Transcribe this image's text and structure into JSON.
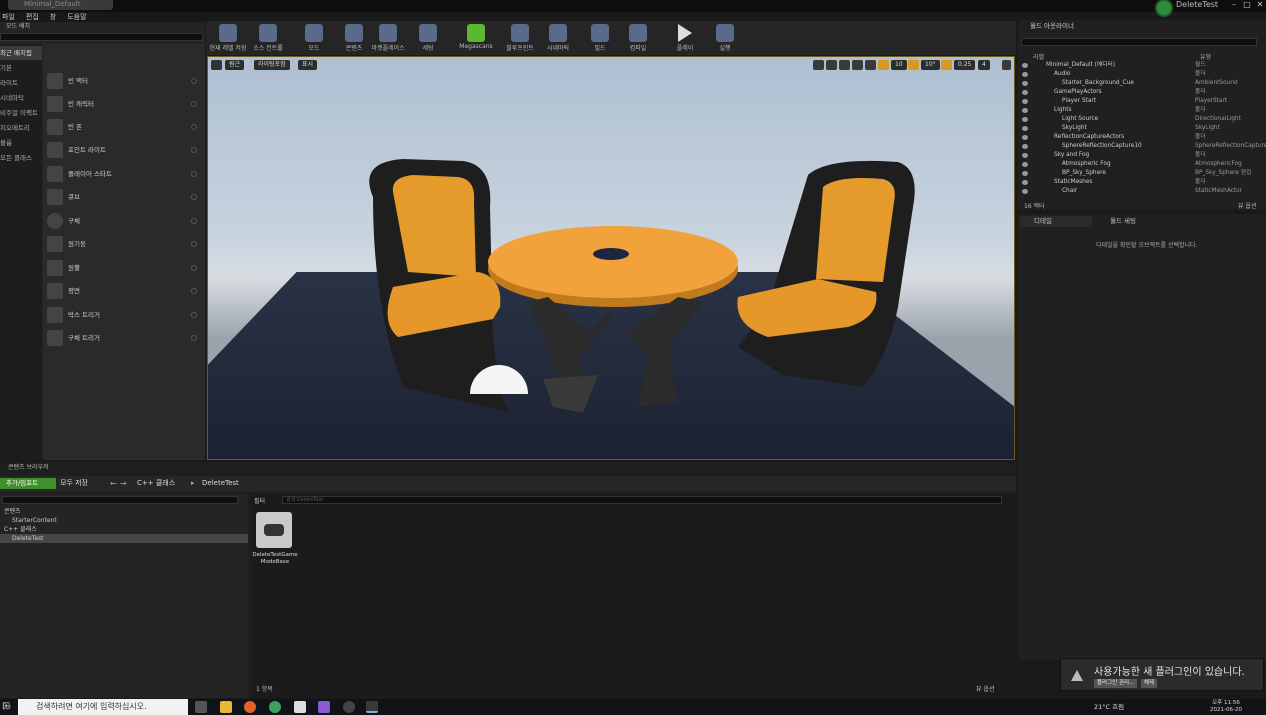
{
  "window": {
    "doc_tab": "Minimal_Default",
    "project_name": "DeleteTest"
  },
  "menu": [
    "파일",
    "편집",
    "창",
    "도움말"
  ],
  "place_panel": {
    "tab": "모드 배치",
    "categories": [
      "최근 배치됨",
      "기본",
      "라이트",
      "시네마틱",
      "비주얼 이펙트",
      "지오메트리",
      "볼륨",
      "모든 클래스"
    ],
    "items": [
      "빈 액터",
      "빈 캐릭터",
      "빈 폰",
      "포인트 라이트",
      "플레이어 스타트",
      "큐브",
      "구체",
      "원기둥",
      "원뿔",
      "평면",
      "박스 트리거",
      "구체 트리거"
    ]
  },
  "toolbar": [
    "현재 레벨 저장",
    "소스 컨트롤",
    "모드",
    "콘텐츠",
    "마켓플레이스",
    "세팅",
    "Megascans",
    "블루프린트",
    "시네마틱",
    "빌드",
    "컴파일",
    "플레이",
    "실행"
  ],
  "viewport": {
    "btn_view": "원근",
    "btn_lit": "라이팅포함",
    "btn_show": "표시",
    "snap_grid": "10",
    "snap_rot": "10°",
    "snap_scale": "0.25",
    "cam_speed": "4"
  },
  "outliner": {
    "tab": "월드 아웃라이너",
    "col_label": "라벨",
    "col_type": "유형",
    "rows": [
      {
        "name": "Minimal_Default (에디터)",
        "type": "월드",
        "indent": 0
      },
      {
        "name": "Audio",
        "type": "폴더",
        "indent": 1
      },
      {
        "name": "Starter_Background_Cue",
        "type": "AmbientSound",
        "indent": 2
      },
      {
        "name": "GamePlayActors",
        "type": "폴더",
        "indent": 1
      },
      {
        "name": "Player Start",
        "type": "PlayerStart",
        "indent": 2
      },
      {
        "name": "Lights",
        "type": "폴더",
        "indent": 1
      },
      {
        "name": "Light Source",
        "type": "DirectionalLight",
        "indent": 2
      },
      {
        "name": "SkyLight",
        "type": "SkyLight",
        "indent": 2
      },
      {
        "name": "ReflectionCaptureActors",
        "type": "폴더",
        "indent": 1
      },
      {
        "name": "SphereReflectionCapture10",
        "type": "SphereReflectionCapture",
        "indent": 2
      },
      {
        "name": "Sky and Fog",
        "type": "폴더",
        "indent": 1
      },
      {
        "name": "Atmospheric Fog",
        "type": "AtmosphericFog",
        "indent": 2
      },
      {
        "name": "BP_Sky_Sphere",
        "type": "BP_Sky_Sphere 편집",
        "indent": 2
      },
      {
        "name": "StaticMeshes",
        "type": "폴더",
        "indent": 1
      },
      {
        "name": "Chair",
        "type": "StaticMeshActor",
        "indent": 2
      }
    ],
    "actor_count": "16 액터",
    "view_options": "뷰 옵션"
  },
  "details": {
    "tab": "디테일",
    "world_tab": "월드 세팅",
    "empty_msg": "디테일을 확인할 오브젝트를 선택합니다."
  },
  "content_browser": {
    "tab": "콘텐츠 브라우저",
    "add_btn": "추가/임포트",
    "save_all": "모두 저장",
    "crumb1": "C++ 클래스",
    "crumb2": "DeleteTest",
    "tree": [
      {
        "name": "콘텐츠",
        "indent": 0,
        "sel": false
      },
      {
        "name": "StarterContent",
        "indent": 1,
        "sel": false
      },
      {
        "name": "C++ 클래스",
        "indent": 0,
        "sel": false
      },
      {
        "name": "DeleteTest",
        "indent": 1,
        "sel": true
      }
    ],
    "filter": "필터",
    "search_placeholder": "검색 DeleteTest",
    "asset_name": "DeleteTestGame ModeBase",
    "item_count": "1 항목",
    "view_options": "뷰 옵션"
  },
  "notification": {
    "text": "사용가능한 새 플러그인이 있습니다.",
    "btn_manage": "플러그인 관리...",
    "btn_dismiss": "해제"
  },
  "taskbar": {
    "search": "검색하려면 여기에 입력하십시오.",
    "weather": "21°C 흐림",
    "time": "오후 11:56",
    "date": "2021-06-20"
  }
}
